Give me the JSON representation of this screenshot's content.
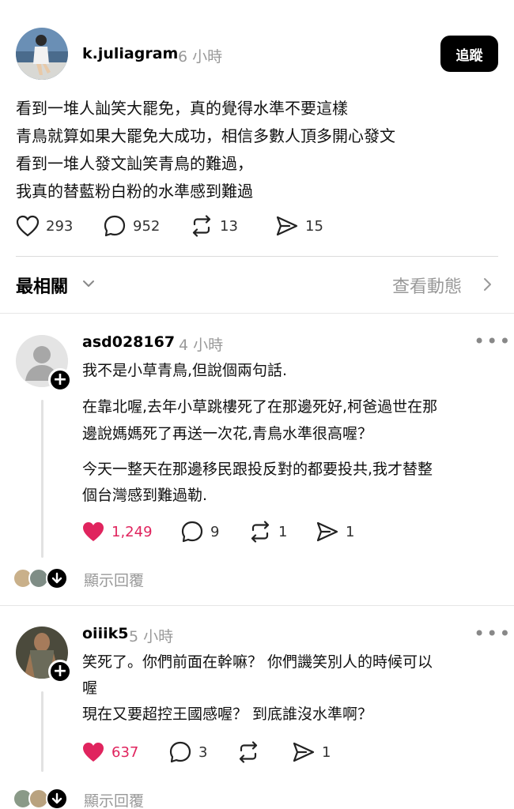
{
  "post": {
    "username": "k.juliagram",
    "time": "6 小時",
    "follow_label": "追蹤",
    "lines": [
      "看到一堆人訕笑大罷免，真的覺得水準不要這樣",
      "青鳥就算如果大罷免大成功，相信多數人頂多開心發文",
      "看到一堆人發文訕笑青鳥的難過，",
      "我真的替藍粉白粉的水準感到難過"
    ],
    "likes": "293",
    "comments": "952",
    "reposts": "13",
    "shares": "15"
  },
  "sort": {
    "label": "最相關",
    "activity_label": "查看動態"
  },
  "comments": [
    {
      "username": "asd028167",
      "time": "4 小時",
      "paragraphs": [
        "我不是小草青鳥,但說個兩句話.",
        "在靠北喔,去年小草跳樓死了在那邊死好,柯爸過世在那",
        "邊說媽媽死了再送一次花,青鳥水準很高喔？",
        "今天一整天在那邊移民跟投反對的都要投共,我才替整",
        "個台灣感到難過勒."
      ],
      "likes": "1,249",
      "comments": "9",
      "reposts": "1",
      "shares": "1",
      "show_replies": "顯示回覆"
    },
    {
      "username": "oiiik5",
      "time": "5 小時",
      "paragraphs": [
        "笑死了。你們前面在幹嘛？ 你們譏笑別人的時候可以",
        "喔",
        "現在又要超控王國感喔？ 到底誰沒水準啊？"
      ],
      "likes": "637",
      "comments": "3",
      "reposts": "",
      "shares": "1",
      "show_replies": "顯示回覆"
    }
  ],
  "colors": {
    "like_active": "#e0245e",
    "muted": "#999999",
    "follow_bg": "#000000"
  }
}
